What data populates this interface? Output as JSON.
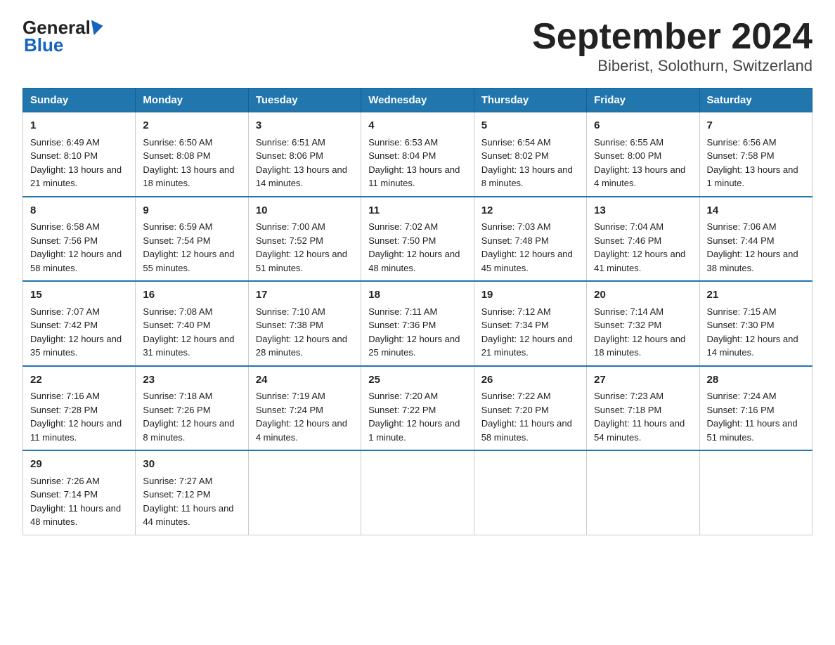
{
  "logo": {
    "text_general": "General",
    "text_blue": "Blue",
    "arrow_label": "logo-arrow"
  },
  "title": "September 2024",
  "subtitle": "Biberist, Solothurn, Switzerland",
  "days_of_week": [
    "Sunday",
    "Monday",
    "Tuesday",
    "Wednesday",
    "Thursday",
    "Friday",
    "Saturday"
  ],
  "weeks": [
    [
      {
        "day": "1",
        "sunrise": "Sunrise: 6:49 AM",
        "sunset": "Sunset: 8:10 PM",
        "daylight": "Daylight: 13 hours and 21 minutes."
      },
      {
        "day": "2",
        "sunrise": "Sunrise: 6:50 AM",
        "sunset": "Sunset: 8:08 PM",
        "daylight": "Daylight: 13 hours and 18 minutes."
      },
      {
        "day": "3",
        "sunrise": "Sunrise: 6:51 AM",
        "sunset": "Sunset: 8:06 PM",
        "daylight": "Daylight: 13 hours and 14 minutes."
      },
      {
        "day": "4",
        "sunrise": "Sunrise: 6:53 AM",
        "sunset": "Sunset: 8:04 PM",
        "daylight": "Daylight: 13 hours and 11 minutes."
      },
      {
        "day": "5",
        "sunrise": "Sunrise: 6:54 AM",
        "sunset": "Sunset: 8:02 PM",
        "daylight": "Daylight: 13 hours and 8 minutes."
      },
      {
        "day": "6",
        "sunrise": "Sunrise: 6:55 AM",
        "sunset": "Sunset: 8:00 PM",
        "daylight": "Daylight: 13 hours and 4 minutes."
      },
      {
        "day": "7",
        "sunrise": "Sunrise: 6:56 AM",
        "sunset": "Sunset: 7:58 PM",
        "daylight": "Daylight: 13 hours and 1 minute."
      }
    ],
    [
      {
        "day": "8",
        "sunrise": "Sunrise: 6:58 AM",
        "sunset": "Sunset: 7:56 PM",
        "daylight": "Daylight: 12 hours and 58 minutes."
      },
      {
        "day": "9",
        "sunrise": "Sunrise: 6:59 AM",
        "sunset": "Sunset: 7:54 PM",
        "daylight": "Daylight: 12 hours and 55 minutes."
      },
      {
        "day": "10",
        "sunrise": "Sunrise: 7:00 AM",
        "sunset": "Sunset: 7:52 PM",
        "daylight": "Daylight: 12 hours and 51 minutes."
      },
      {
        "day": "11",
        "sunrise": "Sunrise: 7:02 AM",
        "sunset": "Sunset: 7:50 PM",
        "daylight": "Daylight: 12 hours and 48 minutes."
      },
      {
        "day": "12",
        "sunrise": "Sunrise: 7:03 AM",
        "sunset": "Sunset: 7:48 PM",
        "daylight": "Daylight: 12 hours and 45 minutes."
      },
      {
        "day": "13",
        "sunrise": "Sunrise: 7:04 AM",
        "sunset": "Sunset: 7:46 PM",
        "daylight": "Daylight: 12 hours and 41 minutes."
      },
      {
        "day": "14",
        "sunrise": "Sunrise: 7:06 AM",
        "sunset": "Sunset: 7:44 PM",
        "daylight": "Daylight: 12 hours and 38 minutes."
      }
    ],
    [
      {
        "day": "15",
        "sunrise": "Sunrise: 7:07 AM",
        "sunset": "Sunset: 7:42 PM",
        "daylight": "Daylight: 12 hours and 35 minutes."
      },
      {
        "day": "16",
        "sunrise": "Sunrise: 7:08 AM",
        "sunset": "Sunset: 7:40 PM",
        "daylight": "Daylight: 12 hours and 31 minutes."
      },
      {
        "day": "17",
        "sunrise": "Sunrise: 7:10 AM",
        "sunset": "Sunset: 7:38 PM",
        "daylight": "Daylight: 12 hours and 28 minutes."
      },
      {
        "day": "18",
        "sunrise": "Sunrise: 7:11 AM",
        "sunset": "Sunset: 7:36 PM",
        "daylight": "Daylight: 12 hours and 25 minutes."
      },
      {
        "day": "19",
        "sunrise": "Sunrise: 7:12 AM",
        "sunset": "Sunset: 7:34 PM",
        "daylight": "Daylight: 12 hours and 21 minutes."
      },
      {
        "day": "20",
        "sunrise": "Sunrise: 7:14 AM",
        "sunset": "Sunset: 7:32 PM",
        "daylight": "Daylight: 12 hours and 18 minutes."
      },
      {
        "day": "21",
        "sunrise": "Sunrise: 7:15 AM",
        "sunset": "Sunset: 7:30 PM",
        "daylight": "Daylight: 12 hours and 14 minutes."
      }
    ],
    [
      {
        "day": "22",
        "sunrise": "Sunrise: 7:16 AM",
        "sunset": "Sunset: 7:28 PM",
        "daylight": "Daylight: 12 hours and 11 minutes."
      },
      {
        "day": "23",
        "sunrise": "Sunrise: 7:18 AM",
        "sunset": "Sunset: 7:26 PM",
        "daylight": "Daylight: 12 hours and 8 minutes."
      },
      {
        "day": "24",
        "sunrise": "Sunrise: 7:19 AM",
        "sunset": "Sunset: 7:24 PM",
        "daylight": "Daylight: 12 hours and 4 minutes."
      },
      {
        "day": "25",
        "sunrise": "Sunrise: 7:20 AM",
        "sunset": "Sunset: 7:22 PM",
        "daylight": "Daylight: 12 hours and 1 minute."
      },
      {
        "day": "26",
        "sunrise": "Sunrise: 7:22 AM",
        "sunset": "Sunset: 7:20 PM",
        "daylight": "Daylight: 11 hours and 58 minutes."
      },
      {
        "day": "27",
        "sunrise": "Sunrise: 7:23 AM",
        "sunset": "Sunset: 7:18 PM",
        "daylight": "Daylight: 11 hours and 54 minutes."
      },
      {
        "day": "28",
        "sunrise": "Sunrise: 7:24 AM",
        "sunset": "Sunset: 7:16 PM",
        "daylight": "Daylight: 11 hours and 51 minutes."
      }
    ],
    [
      {
        "day": "29",
        "sunrise": "Sunrise: 7:26 AM",
        "sunset": "Sunset: 7:14 PM",
        "daylight": "Daylight: 11 hours and 48 minutes."
      },
      {
        "day": "30",
        "sunrise": "Sunrise: 7:27 AM",
        "sunset": "Sunset: 7:12 PM",
        "daylight": "Daylight: 11 hours and 44 minutes."
      },
      null,
      null,
      null,
      null,
      null
    ]
  ]
}
